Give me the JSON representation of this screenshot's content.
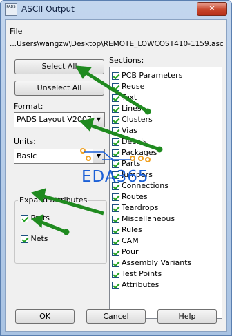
{
  "window": {
    "title": "ASCII Output",
    "app_icon_text": "PADS",
    "close_glyph": "✕"
  },
  "file": {
    "label": "File",
    "path": "...Users\\wangzw\\Desktop\\REMOTE_LOWCOST410-1159.asc"
  },
  "buttons": {
    "select_all": "Select All",
    "unselect_all": "Unselect All",
    "ok": "OK",
    "cancel": "Cancel",
    "help": "Help"
  },
  "format": {
    "label": "Format:",
    "value": "PADS Layout V2007"
  },
  "units": {
    "label": "Units:",
    "value": "Basic"
  },
  "expand": {
    "label": "Expand attributes",
    "parts_label": "Parts",
    "nets_label": "Nets"
  },
  "sections": {
    "label": "Sections:",
    "items": [
      "PCB Parameters",
      "Reuse",
      "Text",
      "Lines",
      "Clusters",
      "Vias",
      "Decals",
      "Packages",
      "Parts",
      "Jumpers",
      "Connections",
      "Routes",
      "Teardrops",
      "Miscellaneous",
      "Rules",
      "CAM",
      "Pour",
      "Assembly Variants",
      "Test Points",
      "Attributes"
    ]
  },
  "watermark": "EDA365",
  "colors": {
    "arrow": "#1f8a1f",
    "watermark": "#1a5fd6",
    "check": "#21a121"
  }
}
